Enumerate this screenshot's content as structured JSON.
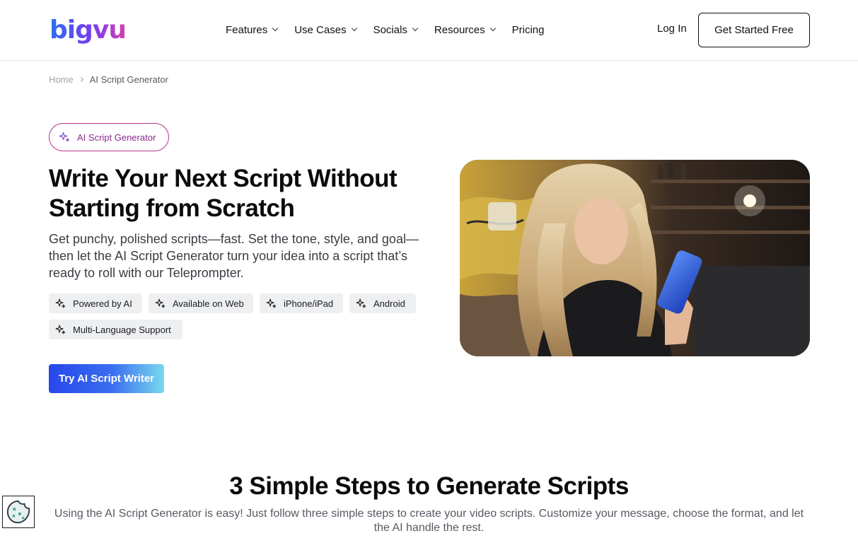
{
  "header": {
    "logo_text": "bigvu",
    "nav": [
      {
        "label": "Features",
        "has_dropdown": true
      },
      {
        "label": "Use Cases",
        "has_dropdown": true
      },
      {
        "label": "Socials",
        "has_dropdown": true
      },
      {
        "label": "Resources",
        "has_dropdown": true
      },
      {
        "label": "Pricing",
        "has_dropdown": false
      }
    ],
    "login_label": "Log In",
    "cta_label": "Get Started Free"
  },
  "breadcrumb": {
    "home": "Home",
    "current": "AI Script Generator"
  },
  "hero": {
    "pill_label": "AI Script Generator",
    "title": "Write Your Next Script Without Starting from Scratch",
    "subtitle": "Get punchy, polished scripts—fast. Set the tone, style, and goal—then let the AI Script Generator turn your idea into a script that’s ready to roll with our Teleprompter.",
    "tags": [
      "Powered by AI",
      "Available on Web",
      "iPhone/iPad",
      "Android",
      "Multi-Language Support"
    ],
    "cta_label": "Try AI Script Writer",
    "image_description": "woman with phone"
  },
  "steps": {
    "title": "3 Simple Steps to Generate Scripts",
    "subtitle": "Using the AI Script Generator is easy! Just follow three simple steps to create your video scripts. Customize your message, choose the format, and let the AI handle the rest."
  },
  "colors": {
    "brand_pink": "#b5368c",
    "cta_blue": "#2747ea",
    "cta_cyan": "#79d9ef",
    "tag_bg": "#eeeff1"
  },
  "icons": {
    "sparkle": "sparkle-icon",
    "chevron": "chevron-down-icon",
    "cookie": "cookie-icon"
  }
}
